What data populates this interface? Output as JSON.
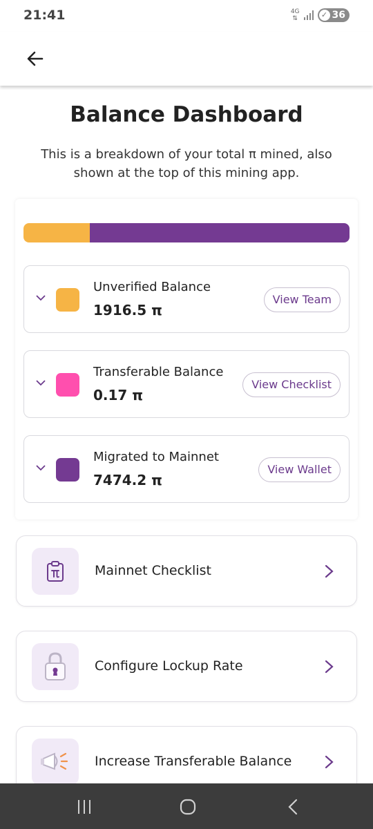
{
  "status_bar": {
    "time": "21:41",
    "network": "4G",
    "battery": "36",
    "icons": [
      "signal-icon",
      "battery-saver-icon"
    ]
  },
  "header": {
    "back_icon": "arrow-left-icon"
  },
  "main": {
    "title": "Balance Dashboard",
    "subtitle": "This is a breakdown of your total π mined, also shown at the top of this mining app."
  },
  "balance_bar": {
    "segments": [
      {
        "name": "Unverified Balance",
        "fraction": 0.204,
        "color": "#f6b445"
      },
      {
        "name": "Transferable Balance",
        "fraction": 0.0,
        "color": "#ff4fae"
      },
      {
        "name": "Migrated to Mainnet",
        "fraction": 0.796,
        "color": "#743a92"
      }
    ]
  },
  "balances": [
    {
      "label": "Unverified Balance",
      "value": "1916.5 π",
      "button": "View Team",
      "color": "#f6b445"
    },
    {
      "label": "Transferable Balance",
      "value": "0.17 π",
      "button": "View Checklist",
      "color": "#ff4fae"
    },
    {
      "label": "Migrated to Mainnet",
      "value": "7474.2 π",
      "button": "View Wallet",
      "color": "#743a92"
    }
  ],
  "actions": [
    {
      "label": "Mainnet Checklist",
      "icon": "clipboard-pi-icon"
    },
    {
      "label": "Configure Lockup Rate",
      "icon": "padlock-icon"
    },
    {
      "label": "Increase Transferable Balance",
      "icon": "megaphone-icon"
    }
  ],
  "nav": {
    "icons": [
      "recent-apps-icon",
      "home-icon",
      "back-icon"
    ]
  },
  "colors": {
    "accent": "#6b3a8c",
    "unverified": "#f6b445",
    "transferable": "#ff4fae",
    "mainnet": "#743a92"
  }
}
